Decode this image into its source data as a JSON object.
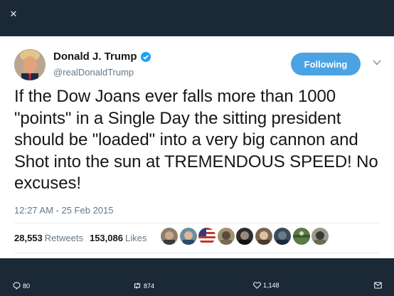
{
  "overlay": {
    "close_icon": "close-icon"
  },
  "tweet": {
    "author_name": "Donald J. Trump",
    "handle": "@realDonaldTrump",
    "verified_icon": "verified-badge-icon",
    "follow_label": "Following",
    "text": "If the Dow Joans ever falls more than 1000 \"points\" in a Single Day the sitting president should be \"loaded\" into a very big cannon and Shot into the sun at TREMENDOUS SPEED! No excuses!",
    "timestamp": "12:27 AM - 25 Feb 2015",
    "retweets_count": "28,553",
    "retweets_label": "Retweets",
    "likes_count": "153,086",
    "likes_label": "Likes"
  },
  "actions": {
    "reply_count": "80",
    "retweet_count": "874",
    "like_count": "1,148"
  },
  "colors": {
    "background": "#1b2836",
    "card": "#ffffff",
    "follow_button": "#4ba3e3",
    "verified": "#1da1f2",
    "secondary_text": "#657786"
  }
}
